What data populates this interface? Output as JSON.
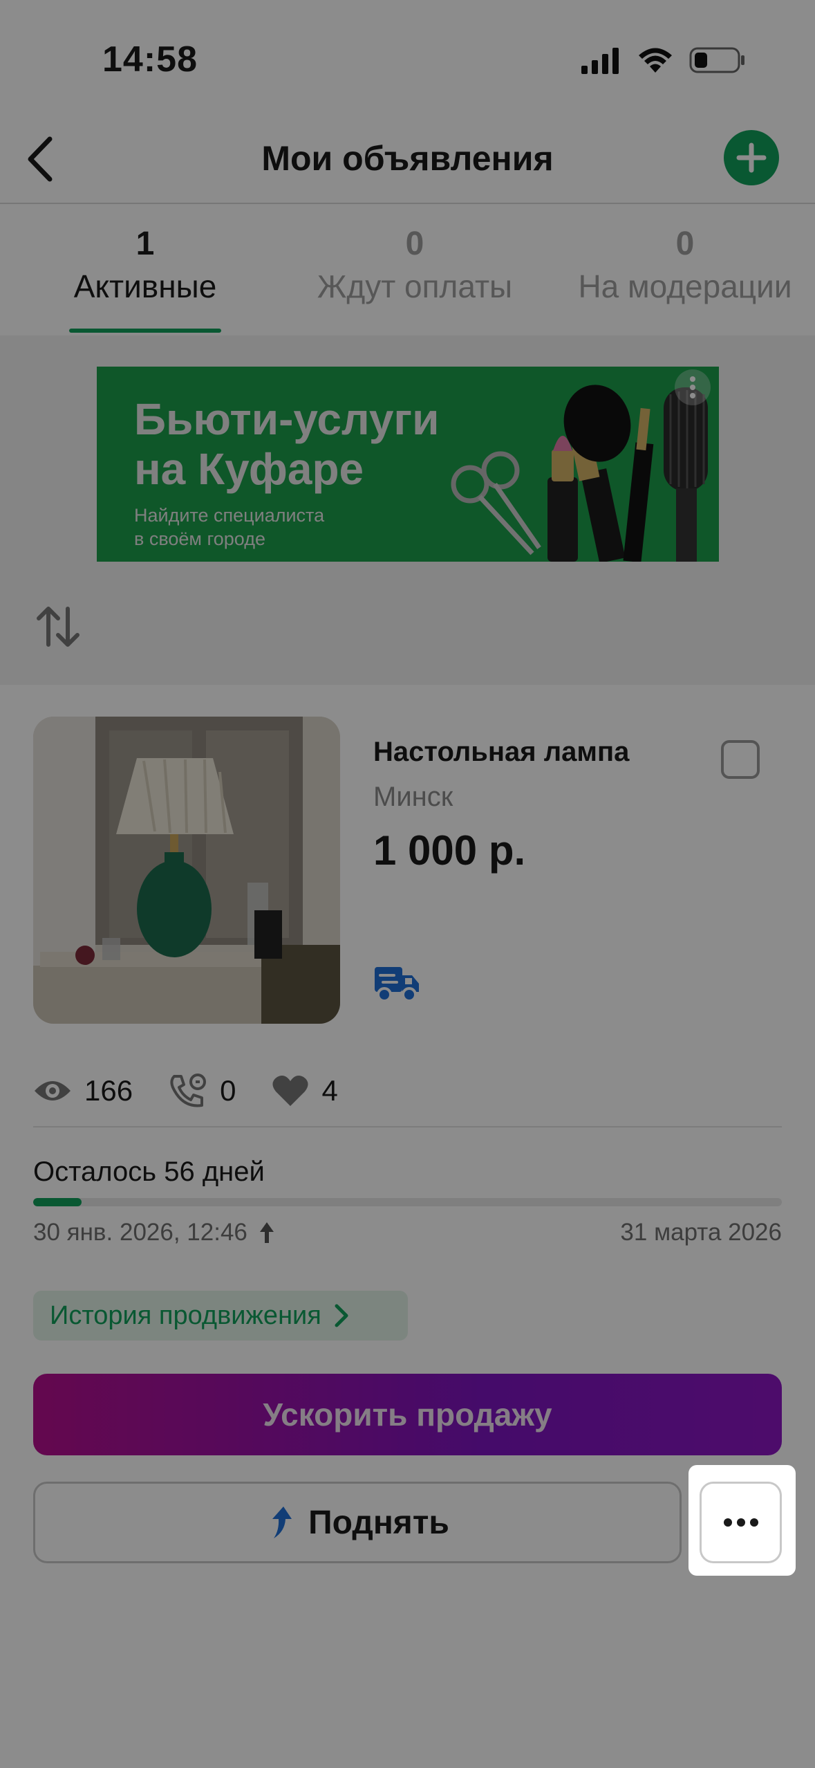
{
  "status_bar": {
    "time": "14:58"
  },
  "nav": {
    "title": "Мои объявления"
  },
  "tabs": [
    {
      "count": "1",
      "label": "Активные"
    },
    {
      "count": "0",
      "label": "Ждут оплаты"
    },
    {
      "count": "0",
      "label": "На модерации"
    }
  ],
  "banner": {
    "title_line1": "Бьюти-услуги",
    "title_line2": "на Куфаре",
    "subtitle_line1": "Найдите специалиста",
    "subtitle_line2": "в своём городе"
  },
  "listing": {
    "title": "Настольная лампа",
    "city": "Минск",
    "price": "1 000 р.",
    "views": "166",
    "calls": "0",
    "favorites": "4",
    "days_left": "Осталось 56 дней",
    "progress_fraction": 0.065,
    "date_start": "30 янв. 2026, 12:46",
    "date_end": "31 марта 2026",
    "history_label": "История продвижения",
    "boost_label": "Ускорить продажу",
    "raise_label": "Поднять"
  },
  "colors": {
    "accent_green": "#11a15c",
    "boost_gradient_start": "#b6108f",
    "boost_gradient_end": "#7e14c1",
    "raise_arrow": "#1f6fd8"
  },
  "icons": [
    "chevron-left-icon",
    "plus-icon",
    "sort-icon",
    "eye-icon",
    "phone-icon",
    "heart-icon",
    "truck-icon",
    "arrow-up-icon",
    "chevron-right-icon",
    "more-dots-icon"
  ]
}
